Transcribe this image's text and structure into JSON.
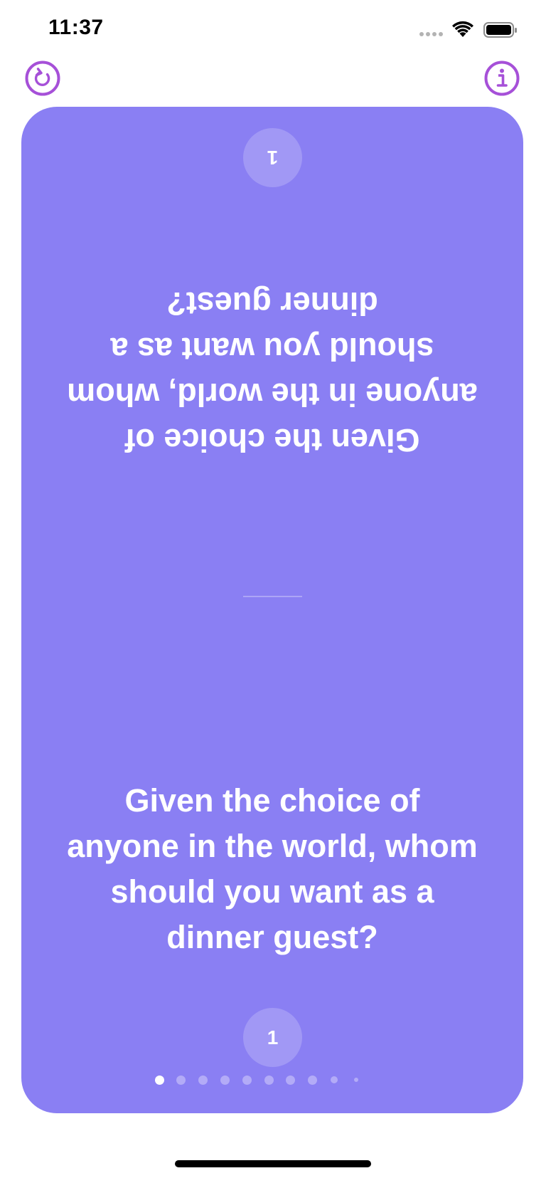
{
  "status_bar": {
    "time": "11:37"
  },
  "toolbar": {
    "restart_icon": "restart-icon",
    "info_icon": "info-icon",
    "accent_color": "#a650d8"
  },
  "card": {
    "background_color": "#8a7ff3",
    "question": "Given the choice of anyone in the world, whom should you want as a dinner guest?",
    "question_lines": [
      "Given the choice of",
      "anyone in the world, whom",
      "should you want as a",
      "dinner guest?"
    ],
    "number": "1"
  },
  "pagination": {
    "total_visible": 10,
    "active_index": 0
  }
}
